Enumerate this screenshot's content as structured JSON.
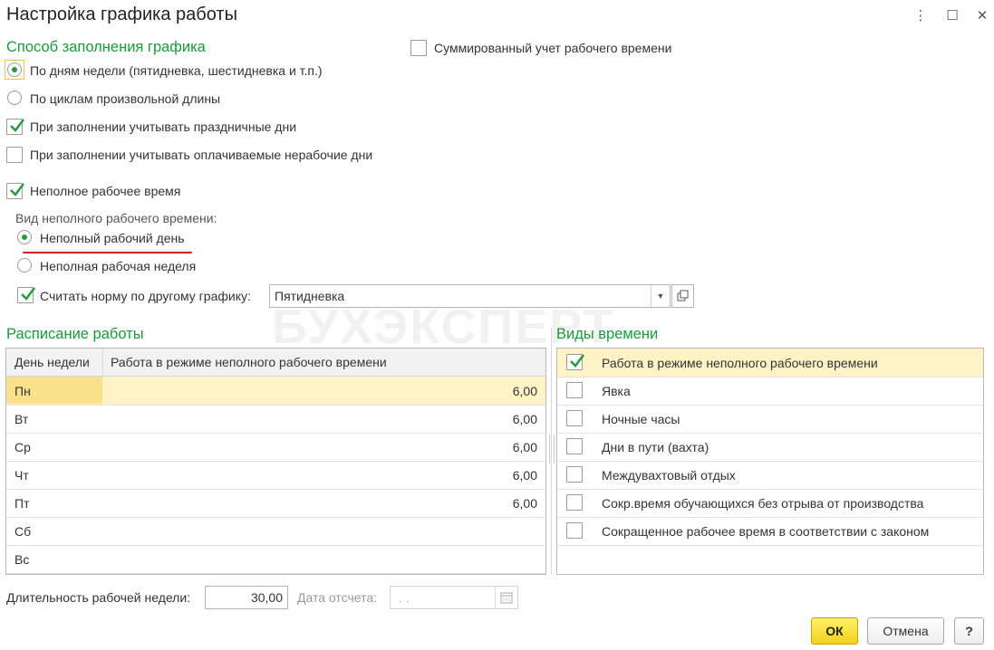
{
  "window": {
    "title": "Настройка графика работы",
    "menu_icon": "⋮",
    "maximize_icon": "☐",
    "close_icon": "✕"
  },
  "fill": {
    "section_title": "Способ заполнения графика",
    "by_weekdays": "По дням недели (пятидневка, шестидневка и т.п.)",
    "by_cycles": "По циклам произвольной длины",
    "holidays": "При заполнении учитывать праздничные дни",
    "paid_nonworking": "При заполнении учитывать оплачиваемые нерабочие дни",
    "summed_accounting": "Суммированный учет рабочего времени"
  },
  "part_time": {
    "label": "Неполное рабочее время",
    "kind_label": "Вид неполного рабочего времени:",
    "day": "Неполный рабочий день",
    "week": "Неполная рабочая неделя",
    "norm_label": "Считать норму по другому графику:",
    "norm_value": "Пятидневка"
  },
  "watermark": "БУХЭКСПЕРТ",
  "schedule": {
    "title": "Расписание работы",
    "col_day": "День недели",
    "col_hours": "Работа в режиме неполного рабочего времени",
    "rows": [
      {
        "day": "Пн",
        "hours": "6,00"
      },
      {
        "day": "Вт",
        "hours": "6,00"
      },
      {
        "day": "Ср",
        "hours": "6,00"
      },
      {
        "day": "Чт",
        "hours": "6,00"
      },
      {
        "day": "Пт",
        "hours": "6,00"
      },
      {
        "day": "Сб",
        "hours": ""
      },
      {
        "day": "Вс",
        "hours": ""
      }
    ]
  },
  "time_types": {
    "title": "Виды времени",
    "items": [
      {
        "label": "Работа в режиме неполного рабочего времени",
        "checked": true
      },
      {
        "label": "Явка",
        "checked": false
      },
      {
        "label": "Ночные часы",
        "checked": false
      },
      {
        "label": "Дни в пути (вахта)",
        "checked": false
      },
      {
        "label": "Междувахтовый отдых",
        "checked": false
      },
      {
        "label": "Сокр.время обучающихся без отрыва от производства",
        "checked": false
      },
      {
        "label": "Сокращенное рабочее время в соответствии с законом",
        "checked": false
      }
    ]
  },
  "footer": {
    "week_length_label": "Длительность рабочей недели:",
    "week_length_value": "30,00",
    "ref_date_label": "Дата отсчета:",
    "ref_date_value": " .  .",
    "ok": "ОК",
    "cancel": "Отмена",
    "help": "?"
  },
  "colors": {
    "accent_green": "#1a9a3a",
    "selected_row": "#fdf3c7",
    "ok_button": "#f3d21a",
    "underline": "#d91e1e"
  }
}
